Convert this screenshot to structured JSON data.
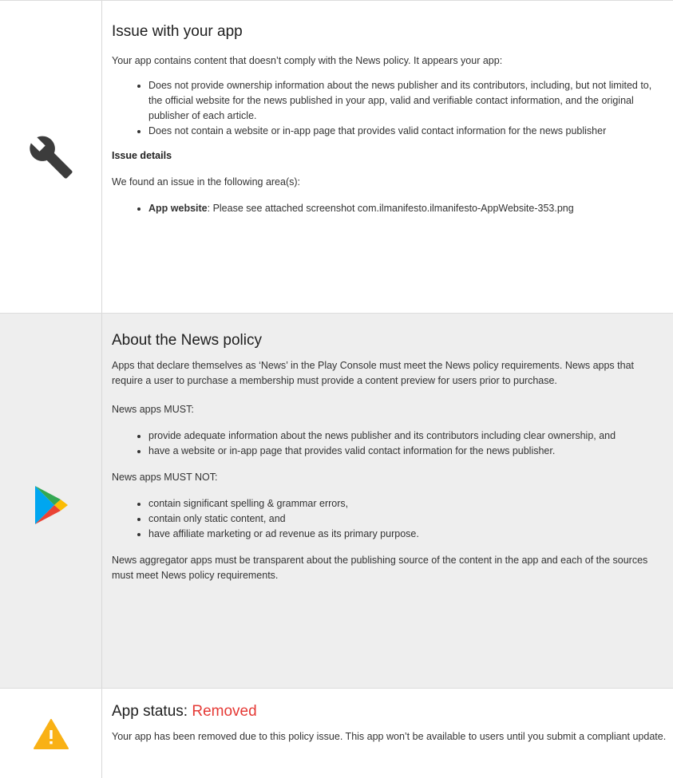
{
  "issue": {
    "title": "Issue with your app",
    "intro": "Your app contains content that doesn’t comply with the News policy. It appears your app:",
    "bullets": [
      "Does not provide ownership information about the news publisher and its contributors, including, but not limited to, the official website for the news published in your app, valid and verifiable contact information, and the original publisher of each article.",
      "Does not contain a website or in-app page that provides valid contact information for the news publisher"
    ],
    "details_heading": "Issue details",
    "details_intro": "We found an issue in the following area(s):",
    "detail_item": {
      "label": "App website",
      "text": ": Please see attached screenshot com.ilmanifesto.ilmanifesto-AppWebsite-353.png"
    }
  },
  "policy": {
    "title": "About the News policy",
    "intro": "Apps that declare themselves as ‘News’ in the Play Console must meet the News policy requirements. News apps that require a user to purchase a membership must provide a content preview for users prior to purchase.",
    "must_heading": "News apps MUST:",
    "must_items": [
      "provide adequate information about the news publisher and its contributors including clear ownership, and",
      "have a website or in-app page that provides valid contact information for the news publisher."
    ],
    "must_not_heading": "News apps MUST NOT:",
    "must_not_items": [
      "contain significant spelling & grammar errors,",
      "contain only static content, and",
      "have affiliate marketing or ad revenue as its primary purpose."
    ],
    "aggregator_note": "News aggregator apps must be transparent about the publishing source of the content in the app and each of the sources must meet News policy requirements."
  },
  "status": {
    "title_prefix": "App status: ",
    "status_value": "Removed",
    "message": "Your app has been removed due to this policy issue. This app won’t be available to users until you submit a compliant update."
  },
  "icons": {
    "issue": "wrench-icon",
    "policy": "google-play-icon",
    "status": "warning-icon"
  },
  "colors": {
    "status_removed": "#e53935",
    "policy_bg": "#eeeeee",
    "warning": "#f9b115"
  }
}
